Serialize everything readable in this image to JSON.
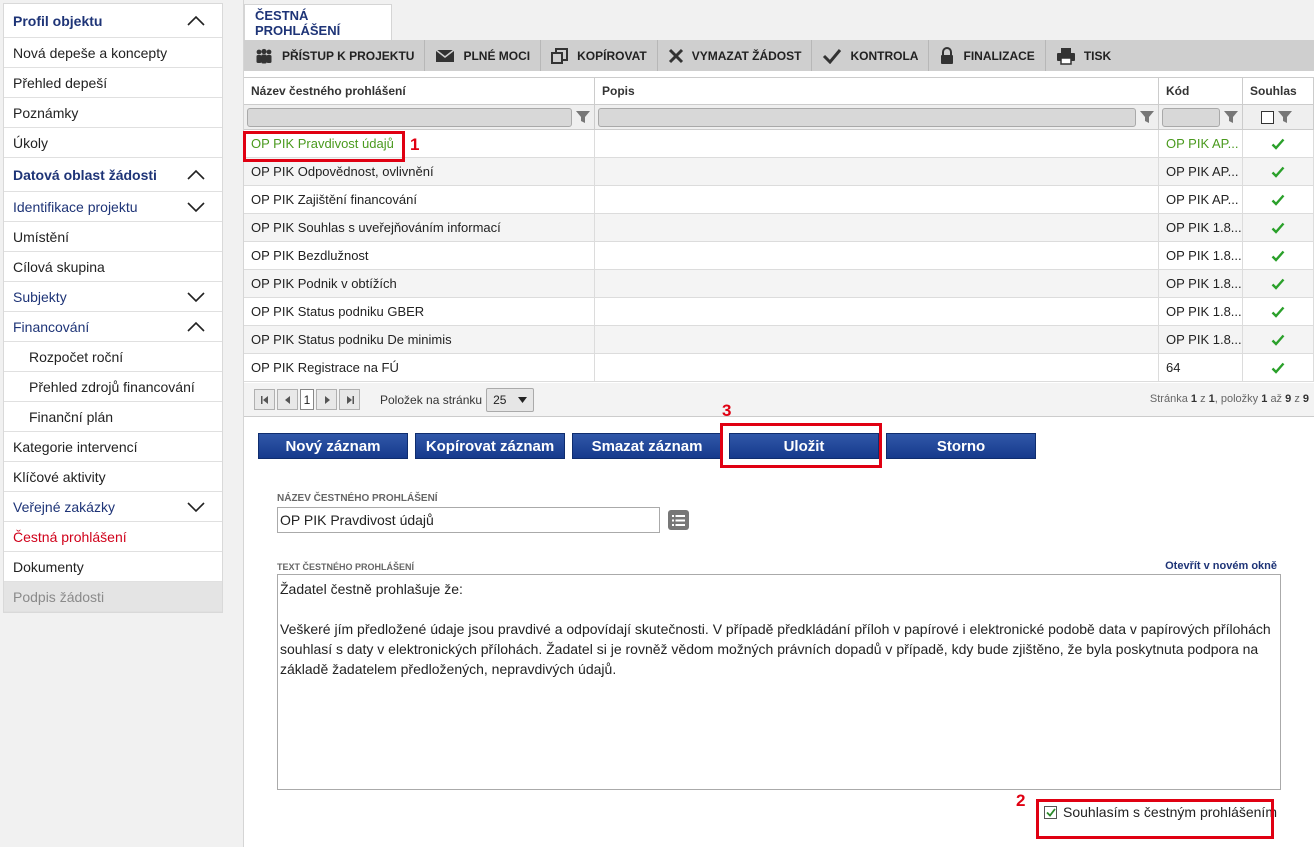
{
  "sidebar": {
    "items": [
      {
        "label": "Profil objektu",
        "kind": "section",
        "chevron": "up"
      },
      {
        "label": "Nová depeše a koncepty",
        "kind": "item"
      },
      {
        "label": "Přehled depeší",
        "kind": "item"
      },
      {
        "label": "Poznámky",
        "kind": "item"
      },
      {
        "label": "Úkoly",
        "kind": "item"
      },
      {
        "label": "Datová oblast žádosti",
        "kind": "section",
        "chevron": "up"
      },
      {
        "label": "Identifikace projektu",
        "kind": "group",
        "chevron": "down"
      },
      {
        "label": "Umístění",
        "kind": "item"
      },
      {
        "label": "Cílová skupina",
        "kind": "item"
      },
      {
        "label": "Subjekty",
        "kind": "group",
        "chevron": "down"
      },
      {
        "label": "Financování",
        "kind": "group",
        "chevron": "up"
      },
      {
        "label": "Rozpočet roční",
        "kind": "sub"
      },
      {
        "label": "Přehled zdrojů financování",
        "kind": "sub"
      },
      {
        "label": "Finanční plán",
        "kind": "sub"
      },
      {
        "label": "Kategorie intervencí",
        "kind": "item"
      },
      {
        "label": "Klíčové aktivity",
        "kind": "item"
      },
      {
        "label": "Veřejné zakázky",
        "kind": "group",
        "chevron": "down"
      },
      {
        "label": "Čestná prohlášení",
        "kind": "active"
      },
      {
        "label": "Dokumenty",
        "kind": "item"
      },
      {
        "label": "Podpis žádosti",
        "kind": "disabled"
      }
    ]
  },
  "tab": {
    "label": "ČESTNÁ PROHLÁŠENÍ"
  },
  "toolbar": {
    "items": [
      {
        "label": "PŘÍSTUP K PROJEKTU",
        "icon": "people-icon"
      },
      {
        "label": "PLNÉ MOCI",
        "icon": "envelope-icon"
      },
      {
        "label": "KOPÍROVAT",
        "icon": "copy-icon"
      },
      {
        "label": "VYMAZAT ŽÁDOST",
        "icon": "close-icon"
      },
      {
        "label": "KONTROLA",
        "icon": "check-icon"
      },
      {
        "label": "FINALIZACE",
        "icon": "lock-icon"
      },
      {
        "label": "TISK",
        "icon": "printer-icon"
      }
    ]
  },
  "grid": {
    "headers": {
      "name": "Název čestného prohlášení",
      "desc": "Popis",
      "code": "Kód",
      "consent": "Souhlas"
    },
    "rows": [
      {
        "name": "OP PIK Pravdivost údajů",
        "desc": "",
        "code": "OP PIK AP...",
        "consent": true
      },
      {
        "name": "OP PIK Odpovědnost, ovlivnění",
        "desc": "",
        "code": "OP PIK AP...",
        "consent": true
      },
      {
        "name": "OP PIK Zajištění financování",
        "desc": "",
        "code": "OP PIK AP...",
        "consent": true
      },
      {
        "name": "OP PIK Souhlas s uveřejňováním informací",
        "desc": "",
        "code": "OP PIK 1.8...",
        "consent": true
      },
      {
        "name": "OP PIK Bezdlužnost",
        "desc": "",
        "code": "OP PIK 1.8...",
        "consent": true
      },
      {
        "name": "OP PIK Podnik v obtížích",
        "desc": "",
        "code": "OP PIK 1.8...",
        "consent": true
      },
      {
        "name": "OP PIK Status podniku GBER",
        "desc": "",
        "code": "OP PIK 1.8...",
        "consent": true
      },
      {
        "name": "OP PIK Status podniku De minimis",
        "desc": "",
        "code": "OP PIK 1.8...",
        "consent": true
      },
      {
        "name": "OP PIK Registrace na FÚ",
        "desc": "",
        "code": "64",
        "consent": true
      }
    ]
  },
  "pager": {
    "current_page": "1",
    "per_page_label": "Položek na stránku",
    "per_page_value": "25",
    "info_prefix": "Stránka",
    "page": "1",
    "of_word": "z",
    "pages": "1",
    "items_word": ", položky",
    "from": "1",
    "to_word": "až",
    "to": "9",
    "total": "9"
  },
  "actions": {
    "new": "Nový záznam",
    "copy": "Kopírovat záznam",
    "delete": "Smazat záznam",
    "save": "Uložit",
    "cancel": "Storno"
  },
  "form": {
    "name_label": "NÁZEV ČESTNÉHO PROHLÁŠENÍ",
    "name_value": "OP PIK Pravdivost údajů",
    "text_label": "TEXT ČESTNÉHO PROHLÁŠENÍ",
    "open_new_window": "Otevřít v novém okně",
    "text_paragraph1": "Žadatel čestně prohlašuje že:",
    "text_paragraph2": "Veškeré jím předložené údaje jsou pravdivé a odpovídají skutečnosti. V případě předkládání příloh v papírové i elektronické podobě data v papírových přílohách souhlasí s daty v elektronických přílohách. Žadatel si je rovněž vědom možných právních dopadů v případě, kdy bude zjištěno, že byla poskytnuta podpora na základě žadatelem předložených, nepravdivých údajů.",
    "consent_label": "Souhlasím s čestným prohlášením",
    "consent_checked": true
  },
  "annotations": {
    "one": "1",
    "two": "2",
    "three": "3"
  },
  "colors": {
    "accent": "#1e3477",
    "annotation": "#e00012",
    "selected_row_text": "#4a9a1e",
    "active_nav": "#d0021b"
  }
}
